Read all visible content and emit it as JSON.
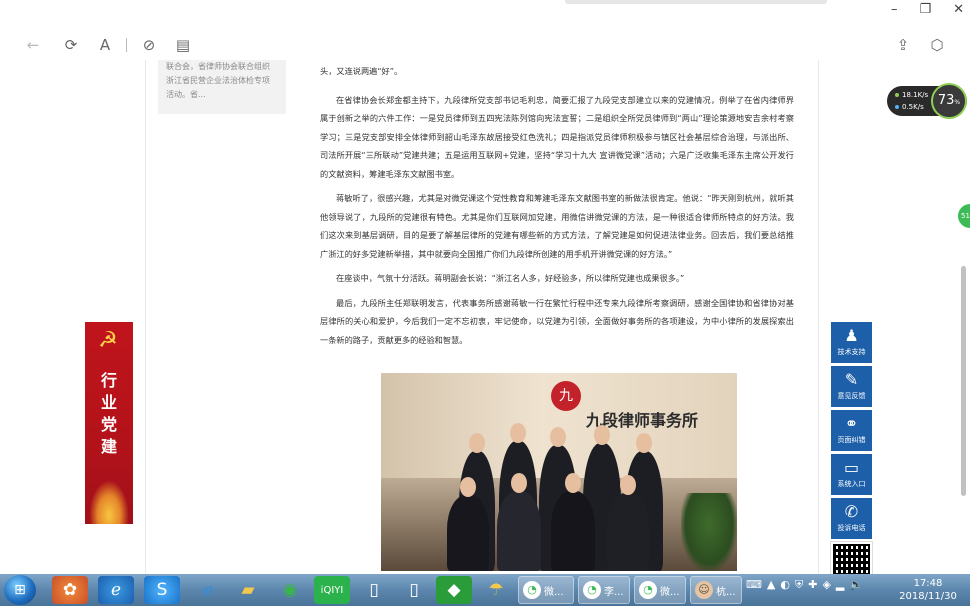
{
  "window": {
    "controls": [
      "–",
      "❐",
      "✕"
    ]
  },
  "toolbar": {
    "back_icon": "←",
    "refresh_icon": "⟳",
    "read_icon": "A",
    "link_icon": "⊘",
    "layout_icon": "▤",
    "share_icon": "⇪",
    "cube_icon": "⬡"
  },
  "side_card": {
    "lines": [
      "联合会，省律师协会联合组织",
      "浙江省民营企业法治体检专项",
      "活动。省..."
    ]
  },
  "banner": {
    "chars": [
      "行",
      "业",
      "党",
      "建"
    ]
  },
  "article": {
    "paragraphs": [
      "头，又连说两遍“好”。",
      "在省律协会长郑金都主持下，九段律所党支部书记毛利忠，简要汇报了九段党支部建立以来的党建情况，例举了在省内律师界属于创新之举的六件工作：一是党员律师到五四宪法陈列馆向宪法宣誓；二是组织全所党员律师到“两山”理论策源地安吉余村考察学习；三是党支部安排全体律师到韶山毛泽东故居接受红色洗礼；四是指派党员律师积极参与镇区社会基层综合治理，与派出所、司法所开展“三所联动”党建共建；五是运用互联网+党建，坚持“学习十九大 宣讲微党课”活动；六是广泛收集毛泽东主席公开发行的文献资料，筹建毛泽东文献图书室。",
      "蒋敏听了，很感兴趣，尤其是对微党课这个党性教育和筹建毛泽东文献图书室的新做法很肯定。他说：“昨天刚到杭州，就听其他领导说了，九段所的党建很有特色。尤其是你们互联网加党建，用微信讲微党课的方法，是一种很适合律师所特点的好方法。我们这次来到基层调研，目的是要了解基层律所的党建有哪些新的方式方法，了解党建是如何促进法律业务。回去后，我们要总结推广浙江的好多党建新举措，其中就要向全国推广你们九段律所创建的用手机开讲微党课的好方法。”",
      "在座谈中，气氛十分活跃。蒋明副会长说：“浙江名人多，好经验多，所以律所党建也成果很多。”",
      "最后，九段所主任郑联明发言，代表事务所感谢蒋敏一行在繁忙行程中还专来九段律所考察调研，感谢全国律协和省律协对基层律所的关心和爱护，今后我们一定不忘初衷，牢记使命，以党建为引领，全面做好事务所的各项建设，为中小律所的发展探索出一条新的路子，贡献更多的经验和智慧。"
    ]
  },
  "photo": {
    "logo_text": "九",
    "sign_text": "九段律师事务所"
  },
  "net_widget": {
    "up": "18.1K/s",
    "down": "0.5K/s",
    "gauge_value": "73",
    "gauge_unit": "%"
  },
  "edge_badge": "51",
  "float_panel": {
    "items": [
      {
        "icon": "tech-support-icon",
        "glyph": "♟",
        "label": "技术支持"
      },
      {
        "icon": "feedback-icon",
        "glyph": "✎",
        "label": "意见反馈"
      },
      {
        "icon": "binoculars-icon",
        "glyph": "⚭",
        "label": "页面纠错"
      },
      {
        "icon": "monitor-icon",
        "glyph": "▭",
        "label": "系统入口"
      },
      {
        "icon": "phone-icon",
        "glyph": "✆",
        "label": "投诉电话"
      }
    ]
  },
  "taskbar": {
    "windows": [
      {
        "label": "微..."
      },
      {
        "label": "李..."
      },
      {
        "label": "微..."
      },
      {
        "label": "杭..."
      }
    ],
    "time": "17:48",
    "date": "2018/11/30"
  },
  "colors": {
    "panel_blue": "#1d5fa9",
    "banner_red": "#c0141c",
    "text": "#333333"
  }
}
